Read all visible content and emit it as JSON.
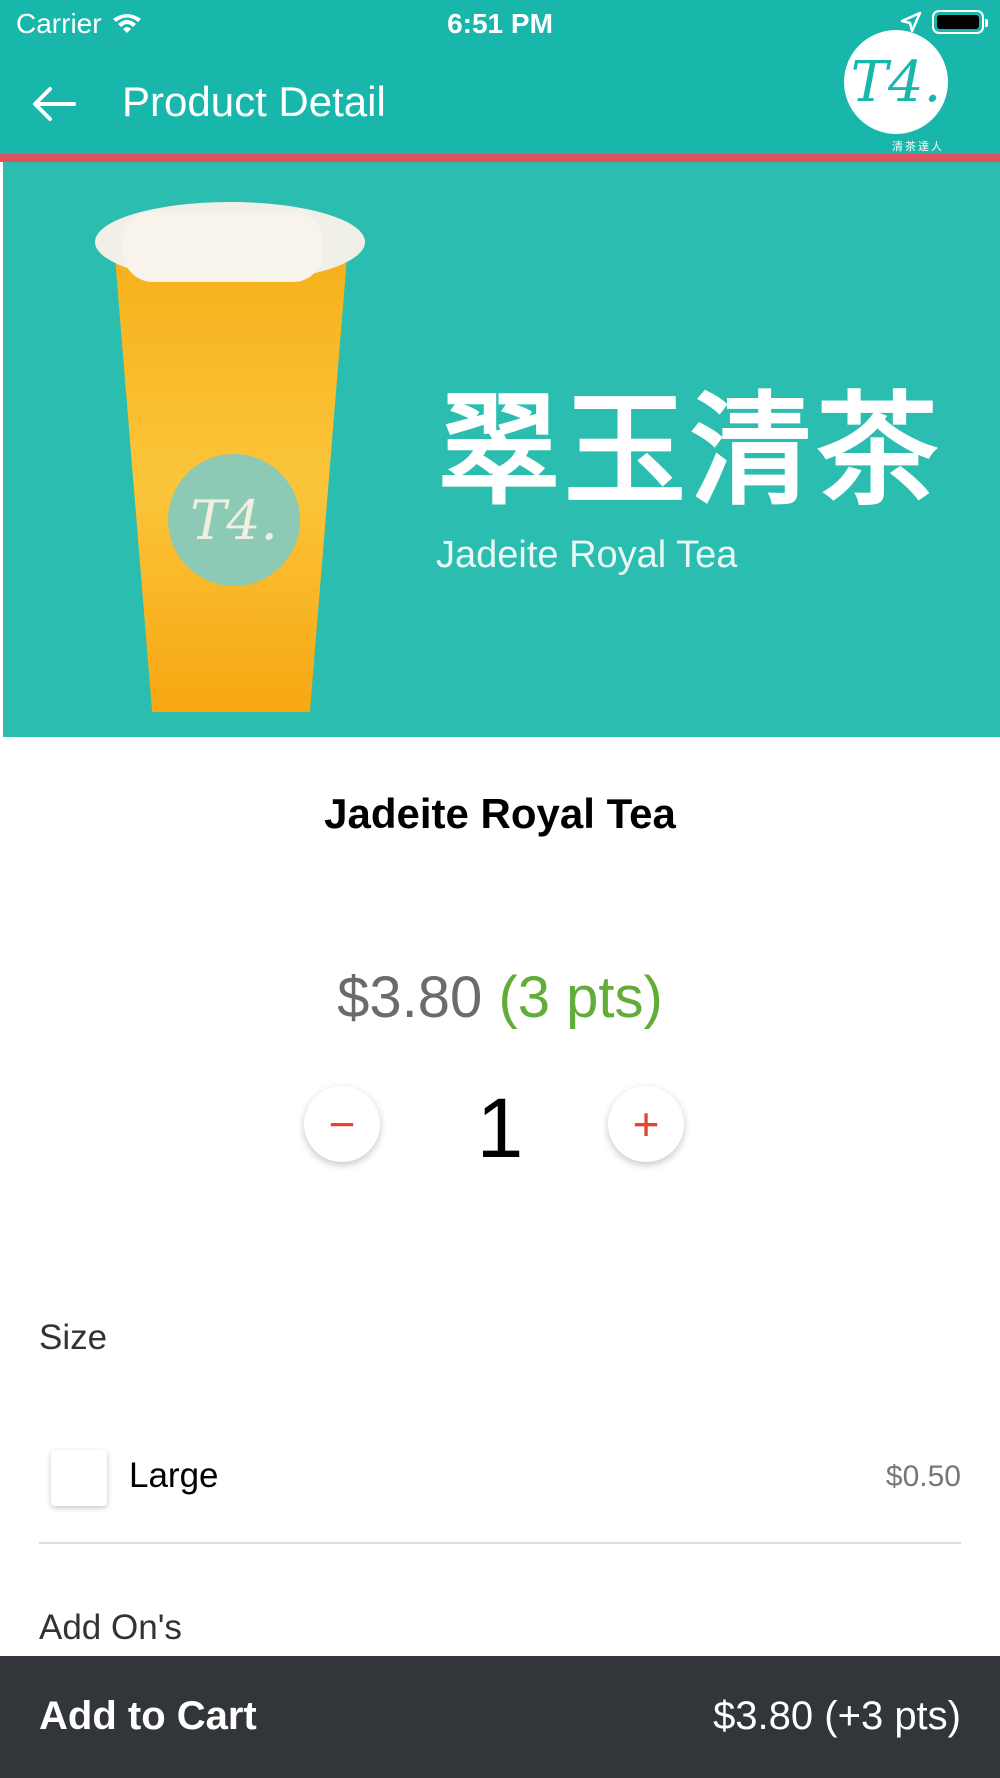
{
  "status_bar": {
    "carrier": "Carrier",
    "time": "6:51 PM",
    "icons": [
      "wifi-icon",
      "location-arrow-icon",
      "battery-icon"
    ]
  },
  "header": {
    "title": "Product Detail",
    "back_icon": "arrow-left-icon",
    "logo_text": "T4.",
    "logo_subtext": "清茶達人"
  },
  "hero": {
    "cn_title": "翠玉清茶",
    "en_title": "Jadeite Royal Tea",
    "cup_emblem": "T4."
  },
  "product": {
    "name": "Jadeite Royal Tea",
    "price": "$3.80",
    "points": "(3 pts)",
    "quantity": "1",
    "minus_symbol": "−",
    "plus_symbol": "+"
  },
  "options": {
    "size_label": "Size",
    "items": [
      {
        "label": "Large",
        "price": "$0.50",
        "checked": false
      }
    ],
    "addons_label": "Add On's"
  },
  "cart": {
    "label": "Add to Cart",
    "total": "$3.80 (+3 pts)"
  },
  "colors": {
    "primary": "#19b7ab",
    "accent_line": "#e0515f",
    "points_green": "#62ad3a",
    "stepper_red": "#e2472b",
    "cart_bar": "#32363a"
  }
}
